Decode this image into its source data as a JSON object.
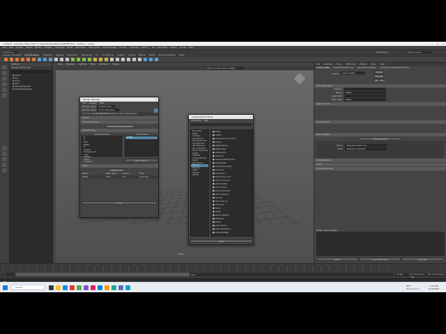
{
  "app": {
    "title": "untitled* - Autodesk MAYA 2023: C:\\Users\\Public\\Maya\\COMMERCIAL\\ - untitled ---  persp"
  },
  "menubar": [
    "File",
    "Edit",
    "Create",
    "Select",
    "Modify",
    "Display",
    "Windows",
    "Mesh",
    "Edit Mesh",
    "Mesh Tools",
    "Mesh Display",
    "Curves",
    "Surfaces",
    "Deform",
    "UV",
    "Generate",
    "Cache",
    "Arnold",
    "Help"
  ],
  "workspace": {
    "label": "Workspace:",
    "value": "Maya Classic"
  },
  "mode_menu": "Modeling",
  "shelf_tabs": [
    "Curves / Surfaces",
    "Poly Modeling",
    "Sculpting",
    "Rigging",
    "Animation",
    "Rendering",
    "FX",
    "FX Caching",
    "Custom",
    "Arnold",
    "Bifrost",
    "MASH",
    "Motion Graphics",
    "XGen"
  ],
  "outliner": {
    "title": "Outliner",
    "menu": [
      "Display",
      "Show",
      "Help"
    ],
    "items": [
      "persp",
      "top",
      "front",
      "side",
      "defaultLightSet",
      "defaultObjectSet"
    ]
  },
  "viewport": {
    "menu": [
      "View",
      "Shading",
      "Lighting",
      "Show",
      "Renderer",
      "Panels"
    ],
    "camera_label": "persp",
    "colorspace": "ACES 1.0 SDR-video (sRGB)"
  },
  "render_settings": {
    "title": "Render Settings",
    "menu": [
      "Edit",
      "Presets",
      "Help"
    ],
    "render_layer_label": "Render Layer",
    "render_layer_value": "masterLayer",
    "render_using_label": "Render Using",
    "render_using_value": "Arnold Renderer",
    "tabs": [
      "Common",
      "Arnold Renderer",
      "System",
      "AOVs",
      "Diagnostics"
    ],
    "sections": [
      "Layers",
      "Arnold Renderer",
      "AOV Browser"
    ],
    "global_label": "Global Denoising (AOV)",
    "aov_columns": [
      "Available AOVs",
      "Active AOVs"
    ],
    "available_aovs": [
      "N",
      "P",
      "Pref",
      "RGBA",
      "Z",
      "albedo",
      "background",
      "coat",
      "diffuse",
      "direct",
      "emission"
    ],
    "active_aovs": [
      "RGBA"
    ],
    "add_custom": "Add Custom",
    "aovs_section": "AOVs",
    "delete_all": "Delete All",
    "table_cols": [
      "Name",
      "Data Type",
      "Driver",
      "Filter"
    ],
    "table_row": [
      "RGBA",
      "rgba",
      "exr",
      "gaussian"
    ],
    "close_label": "Close"
  },
  "create_render_node": {
    "title": "Create Render Node",
    "menu": [
      "Shortcuts",
      "Help"
    ],
    "tree": [
      "Favorites",
      "Maya",
      "Surface",
      "Volumetric",
      "Displacement",
      "2D Textures",
      "3D Textures",
      "Env Textures",
      "Other Textures",
      "Lights",
      "Utilities",
      "Image Planes",
      "Glow",
      "Rendering",
      "Arnold",
      "Texture",
      "Light",
      "Shader",
      "Utility"
    ],
    "nodes": [
      "aiAbs",
      "aiAdd",
      "aiAmbientOcclusion",
      "aiAtan",
      "aiBlackbody",
      "aiBump2d",
      "aiBump3d",
      "aiCache",
      "aiCameraProjection",
      "aiCellNoise",
      "aiCheckerboard",
      "aiClamp",
      "aiClipGeo",
      "aiColorConvert",
      "aiColorCorrect",
      "aiColorJitter",
      "aiCompare",
      "aiComplement",
      "aiComplexIor",
      "aiCross",
      "aiCurvature",
      "aiDivide",
      "aiDot",
      "aiExp",
      "aiFacingRatio",
      "aiFlakes",
      "aiFlat",
      "aiFloatToInt",
      "aiFloatToMatrix",
      "aiFloatToRgb"
    ],
    "close_label": "Close"
  },
  "attribute_editor": {
    "tabs": [
      "List",
      "Selected",
      "Focus",
      "Attributes",
      "Display",
      "Show",
      "Help"
    ],
    "node_tabs": [
      "aiAOV_RGBA",
      "defaultArnoldDriver",
      "defaultArnoldFilter",
      "defaultArnoldRenderOptions"
    ],
    "node_label": "aiAOV:",
    "node_value": "aiAOV_RGBA",
    "buttons": [
      "Focus",
      "Presets",
      "Show",
      "Hide"
    ],
    "sections": [
      "AOV Attributes",
      "Light Groups",
      "Custom AOV",
      "AOV Outputs",
      "Node Behavior",
      "UUID",
      "Extra Attributes"
    ],
    "rows": [
      {
        "label": "Enabled",
        "value": ""
      },
      {
        "label": "Name",
        "value": "RGBA"
      },
      {
        "label": "Light Path",
        "value": ""
      },
      {
        "label": "Data Type",
        "value": "RGBA"
      }
    ],
    "add_new_item": "Add New Item",
    "outputs": [
      {
        "label": "Driver",
        "value": "defaultArnoldDriver"
      },
      {
        "label": "Filter",
        "value": "defaultArnoldFilter"
      }
    ],
    "notes_label": "Notes: aiAOV_RGBA",
    "bottom_buttons": [
      "Select",
      "Load Attributes",
      "Copy Tab"
    ]
  },
  "timeline": {
    "start": "1",
    "end": "120",
    "range_start": "1",
    "range_end": "200",
    "current": "1",
    "fps": "24 fps",
    "char_set": "No Character Set",
    "anim_layer": "No Anim Layer"
  },
  "command_line": {
    "label": "MEL",
    "value": ""
  },
  "taskbar": {
    "search_placeholder": "Search",
    "weather": "66°F",
    "weather_sub": "Partly sunny",
    "time": "2:59 PM",
    "date": "9/20/2024"
  },
  "colors": {
    "accent": "#5285a6",
    "bg": "#444444",
    "dark": "#2b2b2b"
  }
}
